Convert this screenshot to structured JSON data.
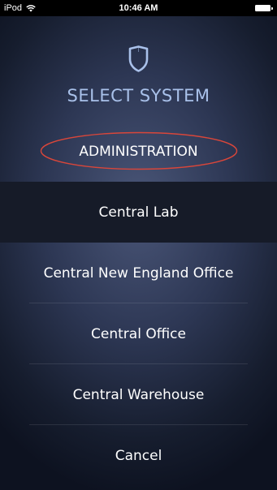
{
  "status_bar": {
    "carrier": "iPod",
    "time": "10:46 AM"
  },
  "header": {
    "logo_icon": "shield-icon",
    "title": "SELECT SYSTEM"
  },
  "menu": {
    "items": [
      {
        "label": "ADMINISTRATION"
      },
      {
        "label": "Central Lab"
      },
      {
        "label": "Central New England Office"
      },
      {
        "label": "Central Office"
      },
      {
        "label": "Central Warehouse"
      },
      {
        "label": "Cancel"
      }
    ]
  },
  "colors": {
    "title": "#a9c1ea",
    "annotation": "#d9463a",
    "selected_row": "#161b28"
  }
}
